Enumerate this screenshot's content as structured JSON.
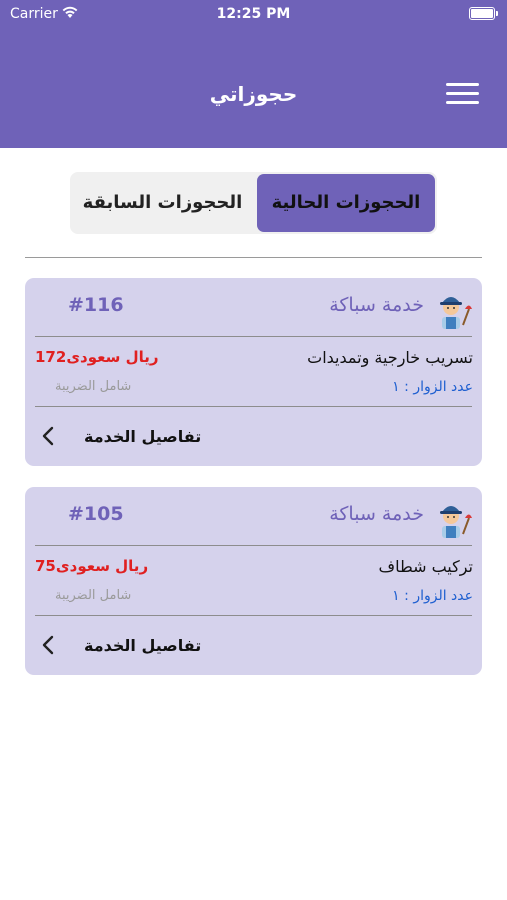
{
  "status_bar": {
    "carrier": "Carrier",
    "time": "12:25 PM"
  },
  "header": {
    "title": "حجوزاتي",
    "menu_icon": "hamburger-menu-icon"
  },
  "tabs": [
    {
      "label": "الحجوزات الحالية",
      "active": true
    },
    {
      "label": "الحجوزات السابقة",
      "active": false
    }
  ],
  "bookings": [
    {
      "service": "خدمة سباكة",
      "number": "#116",
      "description": "تسريب خارجية وتمديدات",
      "price": "172ريال سعودى",
      "tax_note": "شامل الضريبة",
      "visitors": "عدد الزوار : ١",
      "details_label": "تفاصيل الخدمة",
      "icon": "plumber-icon"
    },
    {
      "service": "خدمة سباكة",
      "number": "#105",
      "description": "تركيب شطاف",
      "price": "75ريال سعودى",
      "tax_note": "شامل الضريبة",
      "visitors": "عدد الزوار : ١",
      "details_label": "تفاصيل الخدمة",
      "icon": "plumber-icon"
    }
  ],
  "colors": {
    "accent": "#6f62b8",
    "card_bg": "#d5d2ec",
    "price": "#e02020",
    "visitors": "#1e5fd0"
  }
}
